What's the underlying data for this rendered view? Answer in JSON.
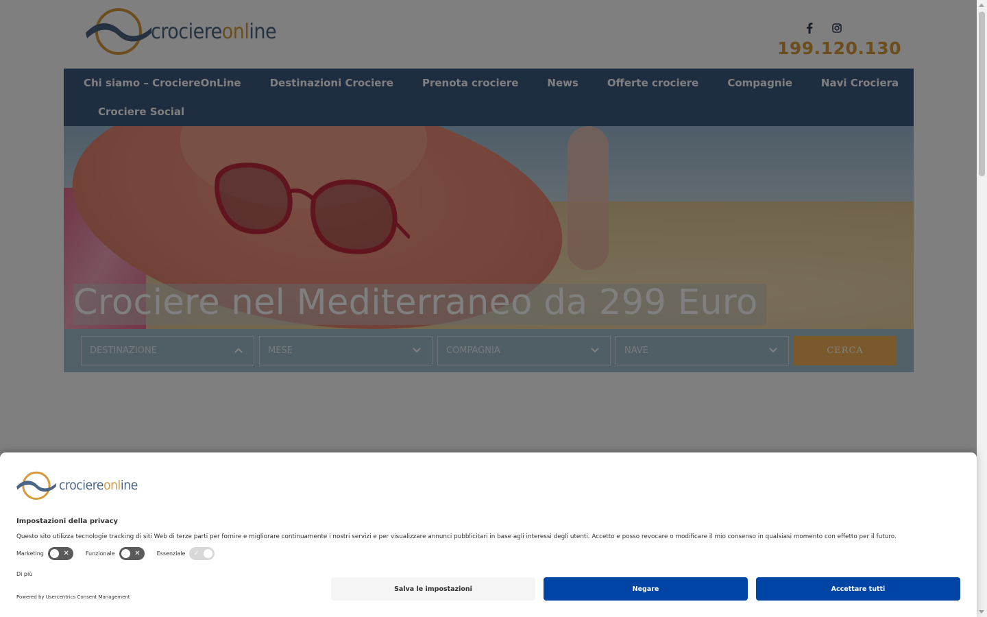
{
  "header": {
    "logo_prefix": "crociere",
    "logo_accent": "onl",
    "logo_suffix": "ine",
    "phone": "199.120.130",
    "social": [
      "facebook-icon",
      "instagram-icon"
    ]
  },
  "nav": {
    "items": [
      "Chi siamo – CrociereOnLine",
      "Destinazioni Crociere",
      "Prenota crociere",
      "News",
      "Offerte crociere",
      "Compagnie",
      "Navi Crociera",
      "Crociere Social"
    ]
  },
  "hero": {
    "title": "Crociere nel Mediterraneo da 299 Euro"
  },
  "search": {
    "fields": [
      "Destinazione",
      "Mese",
      "Compagnia",
      "Nave"
    ],
    "button": "CERCA"
  },
  "consent": {
    "title": "Impostazioni della privacy",
    "text": "Questo sito utilizza tecnologie tracking di siti Web di terze parti per fornire e migliorare continuamente i nostri servizi e per visualizzare annunci pubblicitari in base agli interessi degli utenti. Accetto e posso revocare o modificare il mio consenso in qualsiasi momento con effetto per il futuro.",
    "toggles": [
      {
        "label": "Marketing",
        "state": "off"
      },
      {
        "label": "Funzionale",
        "state": "off"
      },
      {
        "label": "Essenziale",
        "state": "on-disabled"
      }
    ],
    "more": "Di più",
    "powered": "Powered by Usercentrics Consent Management",
    "buttons": {
      "save": "Salva le impostazioni",
      "deny": "Negare",
      "accept": "Accettare tutti"
    }
  },
  "colors": {
    "nav_bg": "#3d5a80",
    "accent": "#d79a3c",
    "cta": "#f5b55a",
    "consent_primary": "#0045a5"
  }
}
